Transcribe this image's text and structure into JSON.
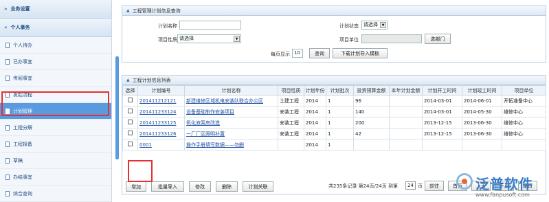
{
  "sidebar": {
    "sections": [
      {
        "label": "业务设置"
      },
      {
        "label": "个人事务"
      }
    ],
    "items": [
      {
        "label": "个人待办"
      },
      {
        "label": "已办事宜"
      },
      {
        "label": "传阅事宜"
      },
      {
        "label": "发起流程"
      },
      {
        "label": "计划管理"
      },
      {
        "label": "工程分解"
      },
      {
        "label": "工程报备"
      },
      {
        "label": "草稿"
      },
      {
        "label": "办结事宜"
      },
      {
        "label": "综合查询"
      }
    ]
  },
  "query_panel": {
    "title": "工程管理计划信息查询",
    "plan_name_label": "计划名称",
    "plan_name_value": "",
    "plan_status_label": "计划状态",
    "plan_status_value": "请选择",
    "project_type_label": "项目性质",
    "project_type_value": "请选择",
    "project_unit_label": "项目单位",
    "project_unit_value": "",
    "select_dept_button": "选部门",
    "page_size_label": "每页显示",
    "page_size_value": "10",
    "query_button": "查询",
    "download_button": "下载计划导入模板"
  },
  "list_panel": {
    "title": "工程计划信息列表",
    "columns": [
      "选择",
      "计划编号",
      "计划名称",
      "项目性质",
      "计划年份",
      "计划批次",
      "投资预算金额",
      "本年计划金额",
      "计划开工时间",
      "计划竣工时间",
      "项目单位"
    ],
    "rows": [
      [
        "201411212121",
        "新建维修区域机电安装队联合办公区",
        "土建工程",
        "2014",
        "1",
        "96",
        "",
        "2014-03-01",
        "2014-06-01",
        "开拓准备中心"
      ],
      [
        "201411233124",
        "设备基础制作安装项目",
        "安装工程",
        "2014",
        "1",
        "140",
        "",
        "2014-03-01",
        "2014-05-30",
        "维修中心"
      ],
      [
        "201411233125",
        "氧化液泵房改造",
        "安装工程",
        "2014",
        "1",
        "200",
        "",
        "2013-12-15",
        "2013-06-30",
        "维修中心"
      ],
      [
        "201411233126",
        "一厂厂区照明补置",
        "安装工程",
        "2014",
        "1",
        "42",
        "",
        "2013-12-15",
        "2013-06-30",
        "维修中心"
      ],
      [
        "0001",
        "操作手册填写数据——勿删",
        "",
        "2014",
        "1",
        "",
        "",
        "",
        "",
        ""
      ]
    ],
    "actions": [
      "增加",
      "批量导入",
      "修改",
      "删除",
      "计划关联"
    ],
    "pagination": {
      "info_prefix": "共235条记录 第24页/24页 到第",
      "page_input": "24",
      "info_suffix": "页",
      "buttons": [
        "前往",
        "首页",
        "上页",
        "下页",
        "尾页"
      ]
    }
  },
  "watermark": {
    "title": "泛普软件",
    "url": "www.fanpusoft.com"
  },
  "colors": {
    "accent": "#5a9be0",
    "highlight": "#e53030",
    "link": "#1b4fa0"
  }
}
